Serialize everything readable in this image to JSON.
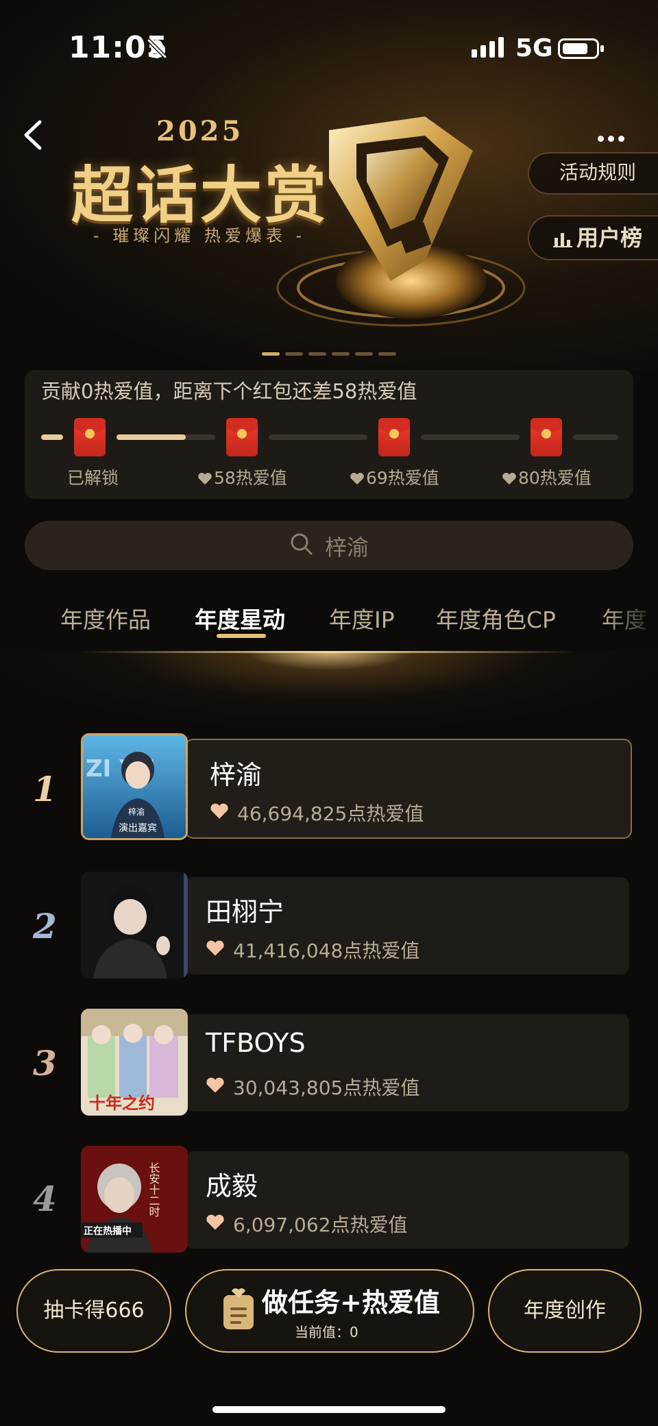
{
  "status_bar": {
    "time": "11:05",
    "network": "5G"
  },
  "header": {
    "year": "2025",
    "title": "超话大赏",
    "subtitle": "- 璀璨闪耀  热爱爆表 -",
    "rules_label": "活动规则",
    "user_rank_label": "用户榜",
    "banner_page_count": 6,
    "banner_active_index": 0
  },
  "contribution": {
    "text": "贡献0热爱值，距离下个红包还差58热爱值",
    "progress_to_next": 0.7,
    "milestones": [
      {
        "label": "已解锁",
        "heart": false
      },
      {
        "label": "58热爱值",
        "heart": true
      },
      {
        "label": "69热爱值",
        "heart": true
      },
      {
        "label": "80热爱值",
        "heart": true
      }
    ]
  },
  "search": {
    "text": "梓渝"
  },
  "tabs": [
    {
      "label": "年度作品",
      "active": false
    },
    {
      "label": "年度星动",
      "active": true
    },
    {
      "label": "年度IP",
      "active": false
    },
    {
      "label": "年度角色CP",
      "active": false
    },
    {
      "label": "年度",
      "active": false
    }
  ],
  "ranking": [
    {
      "rank": "1",
      "name": "梓渝",
      "score": "46,694,825点热爱值",
      "rank_color": "#e8cfa6"
    },
    {
      "rank": "2",
      "name": "田栩宁",
      "score": "41,416,048点热爱值",
      "rank_color": "#a9b6d6"
    },
    {
      "rank": "3",
      "name": "TFBOYS",
      "score": "30,043,805点热爱值",
      "rank_color": "#d8b09a"
    },
    {
      "rank": "4",
      "name": "成毅",
      "score": "6,097,062点热爱值",
      "rank_color": "#9a9a9a"
    }
  ],
  "thumb_texts": {
    "t1_big": "ZI YU",
    "t1_small": "梓渝",
    "t1_caption": "演出嘉宾",
    "t3_caption": "十年之约",
    "t4_title": "长安十二时",
    "t4_badge": "正在热播中"
  },
  "bottom": {
    "draw_label": "抽卡得666",
    "task_label": "做任务+热爱值",
    "task_sub": "当前值：0",
    "create_label": "年度创作"
  },
  "colors": {
    "gold": "#d9b67a",
    "bg": "#0d0b09",
    "card": "#1f1b17",
    "heart": "#f3c5a3"
  }
}
